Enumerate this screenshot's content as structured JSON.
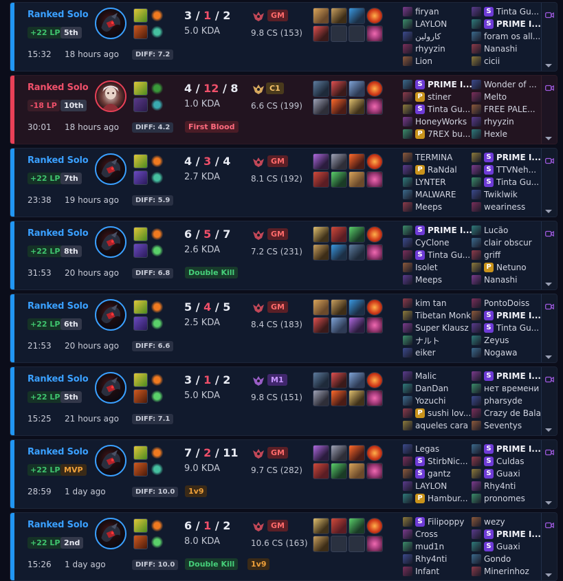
{
  "matches": [
    {
      "result": "win",
      "queue": "Ranked Solo",
      "lp": "+22 LP",
      "placement": "5th",
      "duration": "15:32",
      "ago": "18 hours ago",
      "diff": "DIFF: 7.2",
      "kills": "3",
      "deaths": "1",
      "assists": "2",
      "kda": "5.0 KDA",
      "rank": "GM",
      "cs": "9.8 CS (153)",
      "tags": [],
      "team1": [
        {
          "name": "firyan",
          "badge": ""
        },
        {
          "name": "LAYLON",
          "badge": ""
        },
        {
          "name": "كارولين",
          "badge": ""
        },
        {
          "name": "rhyyzin",
          "badge": ""
        },
        {
          "name": "Lion",
          "badge": ""
        }
      ],
      "team2": [
        {
          "name": "Tinta Gu...",
          "badge": "S"
        },
        {
          "name": "PRIME I...",
          "badge": "S"
        },
        {
          "name": "foram os all...",
          "badge": ""
        },
        {
          "name": "Nanashi",
          "badge": ""
        },
        {
          "name": "cicii",
          "badge": ""
        }
      ]
    },
    {
      "result": "loss",
      "queue": "Ranked Solo",
      "lp": "-18 LP",
      "placement": "10th",
      "duration": "30:01",
      "ago": "18 hours ago",
      "diff": "DIFF: 4.2",
      "kills": "4",
      "deaths": "12",
      "assists": "8",
      "kda": "1.0 KDA",
      "rank": "C1",
      "cs": "6.6 CS (199)",
      "tags": [
        "First Blood"
      ],
      "team1": [
        {
          "name": "PRIME I...",
          "badge": "S"
        },
        {
          "name": "stiner",
          "badge": "P"
        },
        {
          "name": "Tinta Gu...",
          "badge": "S"
        },
        {
          "name": "HoneyWorks",
          "badge": ""
        },
        {
          "name": "7REX bu...",
          "badge": "P"
        }
      ],
      "team2": [
        {
          "name": "Wonder of ...",
          "badge": ""
        },
        {
          "name": "Melto",
          "badge": ""
        },
        {
          "name": "FREE PALE...",
          "badge": ""
        },
        {
          "name": "rhyyzin",
          "badge": ""
        },
        {
          "name": "Hexle",
          "badge": ""
        }
      ]
    },
    {
      "result": "win",
      "queue": "Ranked Solo",
      "lp": "+22 LP",
      "placement": "7th",
      "duration": "23:38",
      "ago": "19 hours ago",
      "diff": "DIFF: 5.9",
      "kills": "4",
      "deaths": "3",
      "assists": "4",
      "kda": "2.7 KDA",
      "rank": "GM",
      "cs": "8.1 CS (192)",
      "tags": [],
      "team1": [
        {
          "name": "TERMINA",
          "badge": ""
        },
        {
          "name": "RaNdal",
          "badge": "P"
        },
        {
          "name": "LYNTER",
          "badge": ""
        },
        {
          "name": "MALWARE",
          "badge": ""
        },
        {
          "name": "Meeps",
          "badge": ""
        }
      ],
      "team2": [
        {
          "name": "PRIME I...",
          "badge": "S"
        },
        {
          "name": "TTVNeh...",
          "badge": "S"
        },
        {
          "name": "Tinta Gu...",
          "badge": "S"
        },
        {
          "name": "Twiklwik",
          "badge": ""
        },
        {
          "name": "weariness",
          "badge": ""
        }
      ]
    },
    {
      "result": "win",
      "queue": "Ranked Solo",
      "lp": "+22 LP",
      "placement": "8th",
      "duration": "31:53",
      "ago": "20 hours ago",
      "diff": "DIFF: 6.8",
      "kills": "6",
      "deaths": "5",
      "assists": "7",
      "kda": "2.6 KDA",
      "rank": "GM",
      "cs": "7.2 CS (231)",
      "tags": [
        "Double Kill"
      ],
      "team1": [
        {
          "name": "PRIME I...",
          "badge": "S"
        },
        {
          "name": "CyClone",
          "badge": ""
        },
        {
          "name": "Tinta Gu...",
          "badge": "S"
        },
        {
          "name": "Isolet",
          "badge": ""
        },
        {
          "name": "Meeps",
          "badge": ""
        }
      ],
      "team2": [
        {
          "name": "Lucão",
          "badge": ""
        },
        {
          "name": "clair obscur",
          "badge": ""
        },
        {
          "name": "griff",
          "badge": ""
        },
        {
          "name": "Netuno",
          "badge": "P"
        },
        {
          "name": "Nanashi",
          "badge": ""
        }
      ]
    },
    {
      "result": "win",
      "queue": "Ranked Solo",
      "lp": "+22 LP",
      "placement": "6th",
      "duration": "21:53",
      "ago": "20 hours ago",
      "diff": "DIFF: 6.6",
      "kills": "5",
      "deaths": "4",
      "assists": "5",
      "kda": "2.5 KDA",
      "rank": "GM",
      "cs": "8.4 CS (183)",
      "tags": [],
      "team1": [
        {
          "name": "kim tan",
          "badge": ""
        },
        {
          "name": "Tibetan Monk",
          "badge": ""
        },
        {
          "name": "Super Klausz",
          "badge": ""
        },
        {
          "name": "ナルト",
          "badge": ""
        },
        {
          "name": "eiker",
          "badge": ""
        }
      ],
      "team2": [
        {
          "name": "PontoDoiss",
          "badge": ""
        },
        {
          "name": "PRIME I...",
          "badge": "S"
        },
        {
          "name": "Tinta Gu...",
          "badge": "S"
        },
        {
          "name": "Zeyus",
          "badge": ""
        },
        {
          "name": "Nogawa",
          "badge": ""
        }
      ]
    },
    {
      "result": "win",
      "queue": "Ranked Solo",
      "lp": "+22 LP",
      "placement": "5th",
      "duration": "15:25",
      "ago": "21 hours ago",
      "diff": "DIFF: 7.1",
      "kills": "3",
      "deaths": "1",
      "assists": "2",
      "kda": "5.0 KDA",
      "rank": "M1",
      "cs": "9.8 CS (151)",
      "tags": [],
      "team1": [
        {
          "name": "Malic",
          "badge": ""
        },
        {
          "name": "DanDan",
          "badge": ""
        },
        {
          "name": "Yozuchi",
          "badge": ""
        },
        {
          "name": "sushi lov...",
          "badge": "P"
        },
        {
          "name": "aqueles cara",
          "badge": ""
        }
      ],
      "team2": [
        {
          "name": "PRIME I...",
          "badge": "S"
        },
        {
          "name": "нет времени",
          "badge": ""
        },
        {
          "name": "pharsyde",
          "badge": ""
        },
        {
          "name": "Crazy de Bala",
          "badge": ""
        },
        {
          "name": "Seventys",
          "badge": ""
        }
      ]
    },
    {
      "result": "win",
      "queue": "Ranked Solo",
      "lp": "+22 LP",
      "placement": "MVP",
      "duration": "28:59",
      "ago": "1 day ago",
      "diff": "DIFF: 10.0",
      "kills": "7",
      "deaths": "2",
      "assists": "11",
      "kda": "9.0 KDA",
      "rank": "GM",
      "cs": "9.7 CS (282)",
      "tags": [
        "1v9"
      ],
      "team1": [
        {
          "name": "Legas",
          "badge": ""
        },
        {
          "name": "StirbNic...",
          "badge": "S"
        },
        {
          "name": "gantz",
          "badge": "S"
        },
        {
          "name": "LAYLON",
          "badge": ""
        },
        {
          "name": "Hambur...",
          "badge": "P"
        }
      ],
      "team2": [
        {
          "name": "PRIME I...",
          "badge": "S"
        },
        {
          "name": "Culdas",
          "badge": "S"
        },
        {
          "name": "Guaxi",
          "badge": "S"
        },
        {
          "name": "Rhy4nti",
          "badge": ""
        },
        {
          "name": "pronomes",
          "badge": ""
        }
      ]
    },
    {
      "result": "win",
      "queue": "Ranked Solo",
      "lp": "+22 LP",
      "placement": "2nd",
      "duration": "15:26",
      "ago": "1 day ago",
      "diff": "DIFF: 10.0",
      "kills": "6",
      "deaths": "1",
      "assists": "2",
      "kda": "8.0 KDA",
      "rank": "GM",
      "cs": "10.6 CS (163)",
      "tags": [
        "Double Kill",
        "1v9"
      ],
      "team1": [
        {
          "name": "Filipoppy",
          "badge": "S"
        },
        {
          "name": "Cross",
          "badge": ""
        },
        {
          "name": "mud1n",
          "badge": ""
        },
        {
          "name": "Rhy4nti",
          "badge": ""
        },
        {
          "name": "Infant",
          "badge": ""
        }
      ],
      "team2": [
        {
          "name": "wezy",
          "badge": ""
        },
        {
          "name": "PRIME I...",
          "badge": "S"
        },
        {
          "name": "Guaxi",
          "badge": "S"
        },
        {
          "name": "Gondo",
          "badge": ""
        },
        {
          "name": "Minerinhoz",
          "badge": ""
        }
      ]
    }
  ],
  "colors": {
    "win_accent": "#2196f3",
    "loss_accent": "#e84057",
    "lp_gain": "#3fc46e",
    "deaths": "#f0506a",
    "badge_s": "#6e3bd6",
    "badge_p": "#c9931b"
  },
  "icons": {
    "champion": "champion-portrait-icon",
    "spells": "summoner-spell-icon",
    "items": "item-icon",
    "rank": "rank-emblem-icon",
    "video": "video-camera-icon",
    "expand": "chevron-down-icon"
  }
}
